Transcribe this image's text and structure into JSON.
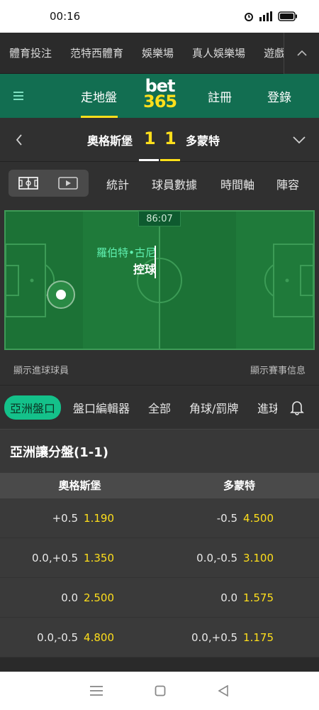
{
  "status": {
    "time": "00:16"
  },
  "sports_nav": {
    "items": [
      "體育投注",
      "范特西體育",
      "娛樂場",
      "真人娛樂場",
      "遊戲"
    ]
  },
  "header": {
    "in_play": "走地盤",
    "logo_top": "bet",
    "logo_bottom": "365",
    "register": "註冊",
    "login": "登錄",
    "accent_color": "#ffdf1b"
  },
  "match": {
    "home": "奧格斯堡",
    "away": "多蒙特",
    "home_score": "1",
    "away_score": "1"
  },
  "tabs": {
    "stats": "統計",
    "player_data": "球員數據",
    "timeline": "時間軸",
    "lineup": "陣容"
  },
  "pitch": {
    "clock": "86:07",
    "player": "羅伯特•古尼",
    "event": "控球"
  },
  "info": {
    "show_scorers": "顯示進球球員",
    "show_match_info": "顯示賽事信息"
  },
  "market_tabs": {
    "asian": "亞洲盤口",
    "editor": "盤口編輯器",
    "all": "全部",
    "corners": "角球/罰牌",
    "goals": "進球"
  },
  "market": {
    "title": "亞洲讓分盤(1-1)",
    "home_col": "奧格斯堡",
    "away_col": "多蒙特",
    "rows": [
      {
        "home_hcp": "+0.5",
        "home_price": "1.190",
        "away_hcp": "-0.5",
        "away_price": "4.500"
      },
      {
        "home_hcp": "0.0,+0.5",
        "home_price": "1.350",
        "away_hcp": "0.0,-0.5",
        "away_price": "3.100"
      },
      {
        "home_hcp": "0.0",
        "home_price": "2.500",
        "away_hcp": "0.0",
        "away_price": "1.575"
      },
      {
        "home_hcp": "0.0,-0.5",
        "home_price": "4.800",
        "away_hcp": "0.0,+0.5",
        "away_price": "1.175"
      }
    ]
  }
}
